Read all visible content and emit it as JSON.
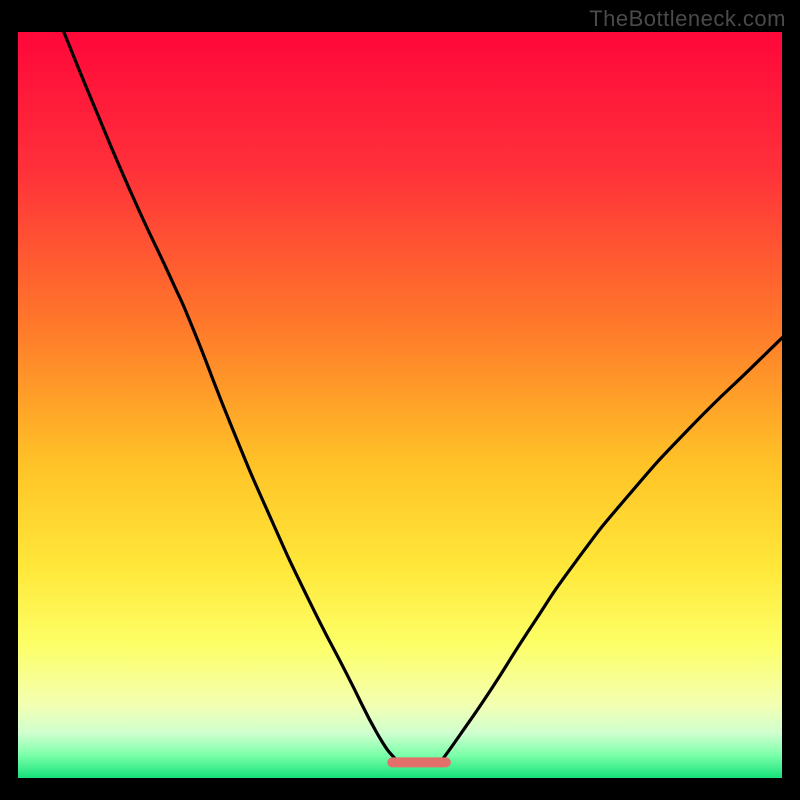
{
  "watermark": "TheBottleneck.com",
  "chart_data": {
    "type": "line",
    "title": "",
    "xlabel": "",
    "ylabel": "",
    "xlim": [
      0,
      100
    ],
    "ylim": [
      0,
      100
    ],
    "background_gradient": {
      "stops": [
        {
          "pos": 0.0,
          "color": "#ff073a"
        },
        {
          "pos": 0.18,
          "color": "#ff2f3a"
        },
        {
          "pos": 0.4,
          "color": "#ff7b2a"
        },
        {
          "pos": 0.58,
          "color": "#ffc327"
        },
        {
          "pos": 0.72,
          "color": "#ffe83a"
        },
        {
          "pos": 0.82,
          "color": "#fdff66"
        },
        {
          "pos": 0.9,
          "color": "#f4ffb0"
        },
        {
          "pos": 0.94,
          "color": "#cfffcf"
        },
        {
          "pos": 0.97,
          "color": "#7affa8"
        },
        {
          "pos": 1.0,
          "color": "#15e27a"
        }
      ]
    },
    "series": [
      {
        "name": "left-branch",
        "x": [
          6,
          10,
          15,
          20,
          23,
          28,
          33,
          38,
          43,
          47,
          49.5
        ],
        "values": [
          100,
          90,
          78,
          67,
          60,
          47,
          35,
          24,
          14,
          6,
          2.4
        ]
      },
      {
        "name": "right-branch",
        "x": [
          55.5,
          58,
          62,
          67,
          73,
          80,
          88,
          96,
          100
        ],
        "values": [
          2.4,
          6,
          12,
          20,
          29,
          38,
          47,
          55,
          59
        ]
      }
    ],
    "segment_marker": {
      "x_start": 49,
      "x_end": 56,
      "y": 2.1,
      "color": "#e36f6a",
      "thickness": 10
    }
  }
}
